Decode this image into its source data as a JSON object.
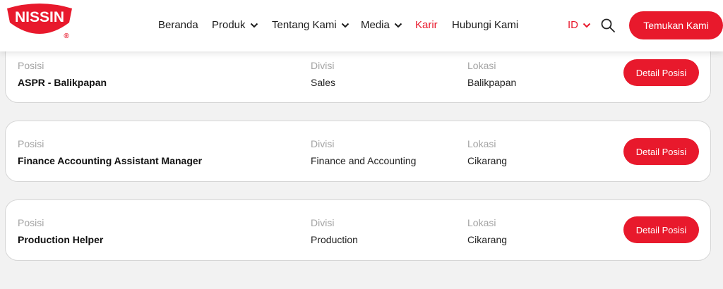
{
  "brand": {
    "logo_text": "NISSIN",
    "registered_mark": "®",
    "primary_color": "#e8192c"
  },
  "nav": {
    "items": [
      {
        "label": "Beranda",
        "dropdown": false,
        "active": false
      },
      {
        "label": "Produk",
        "dropdown": true,
        "active": false
      },
      {
        "label": "Tentang Kami",
        "dropdown": true,
        "active": false
      },
      {
        "label": "Media",
        "dropdown": true,
        "active": false
      },
      {
        "label": "Karir",
        "dropdown": false,
        "active": true
      },
      {
        "label": "Hubungi Kami",
        "dropdown": false,
        "active": false
      }
    ],
    "language": "ID",
    "search_icon": "search-icon",
    "cta_label": "Temukan Kami"
  },
  "jobs": {
    "labels": {
      "position": "Posisi",
      "division": "Divisi",
      "location": "Lokasi"
    },
    "button_label": "Detail Posisi",
    "items": [
      {
        "position": "ASPR - Balikpapan",
        "division": "Sales",
        "location": "Balikpapan"
      },
      {
        "position": "Finance Accounting Assistant Manager",
        "division": "Finance and Accounting",
        "location": "Cikarang"
      },
      {
        "position": "Production Helper",
        "division": "Production",
        "location": "Cikarang"
      }
    ]
  }
}
